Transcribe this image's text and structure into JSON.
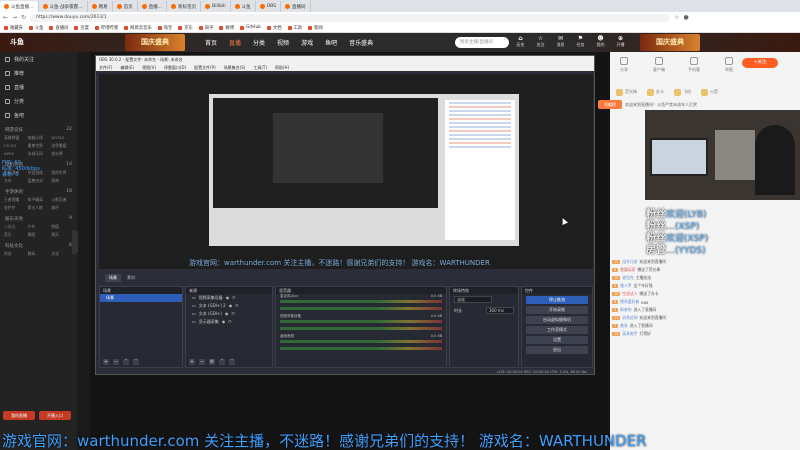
{
  "browser": {
    "tabs": [
      "斗鱼直播…",
      "斗鱼-战争雷霆…",
      "网易",
      "首页",
      "直播…",
      "新标签页",
      "Bilibili",
      "斗鱼",
      "OBS",
      "直播间"
    ],
    "url": "https://www.douyu.com/2613/1",
    "bookmarks": [
      "收藏夹",
      "斗鱼",
      "直播间",
      "百度",
      "哔哩哔哩",
      "网易云音乐",
      "淘宝",
      "京东",
      "知乎",
      "微博",
      "GitHub",
      "文档",
      "工具",
      "新闻"
    ]
  },
  "site": {
    "logo": "斗鱼",
    "promo_left": "国庆盛典",
    "promo_right": "国庆盛典",
    "nav": [
      "首页",
      "直播",
      "分类",
      "视频",
      "游戏",
      "鱼吧",
      "音乐盛典"
    ],
    "search_placeholder": "搜索主播/直播间",
    "header_icons": [
      {
        "glyph": "⌂",
        "label": "历史"
      },
      {
        "glyph": "☆",
        "label": "关注"
      },
      {
        "glyph": "✉",
        "label": "消息"
      },
      {
        "glyph": "⚑",
        "label": "任务"
      },
      {
        "glyph": "☻",
        "label": "我的"
      },
      {
        "glyph": "⊕",
        "label": "开播"
      }
    ]
  },
  "sidebar": {
    "main": [
      {
        "label": "我的关注",
        "icon": "heart-icon"
      },
      {
        "label": "推荐",
        "icon": "star-icon"
      },
      {
        "label": "直播",
        "icon": "tv-icon"
      },
      {
        "label": "分类",
        "icon": "grid-icon"
      },
      {
        "label": "鱼吧",
        "icon": "chat-icon"
      }
    ],
    "sections": [
      {
        "title": "网游竞技",
        "count": "22",
        "items": [
          "英雄联盟",
          "穿越火线",
          "DOTA2",
          "CS:GO",
          "魔兽世界",
          "战争雷霆",
          "APEX",
          "永劫无间",
          "逆水寒"
        ]
      },
      {
        "title": "单机热游",
        "count": "14",
        "items": [
          "主机游戏",
          "怀旧游戏",
          "我的世界",
          "方舟",
          "猛兽派对",
          "原神"
        ]
      },
      {
        "title": "手游休闲",
        "count": "18",
        "items": [
          "王者荣耀",
          "和平精英",
          "火影忍者",
          "金铲铲",
          "第五人格",
          "崩坏"
        ]
      },
      {
        "title": "娱乐天地",
        "count": "9",
        "items": [
          "二次元",
          "户外",
          "颜值",
          "音乐",
          "舞蹈",
          "聊天"
        ]
      },
      {
        "title": "科技文化",
        "count": "6",
        "items": [
          "科技",
          "数码",
          "文化"
        ]
      }
    ],
    "bottom_buttons": [
      "我的直播",
      "开播入口"
    ]
  },
  "obs": {
    "title": "OBS 30.0.2 - 配置文件: 未命名 - 场景: 未命名",
    "menu": [
      "文件(F)",
      "编辑(E)",
      "视图(V)",
      "停靠窗口(D)",
      "配置文件(P)",
      "场景集合(S)",
      "工具(T)",
      "帮助(H)"
    ],
    "caption": "游戏官网：warthunder.com 关注主播，不迷路！感谢兄弟们的支持！ 游戏名：WARTHUNDER",
    "tabs": [
      "场景",
      "素材"
    ],
    "docks": {
      "scenes": {
        "title": "场景",
        "items": [
          "场景"
        ]
      },
      "sources": {
        "title": "来源",
        "items": [
          "视频采集设备",
          "文本 (GDI+) 2",
          "文本 (GDI+)",
          "显示器采集"
        ]
      },
      "mixer": {
        "title": "混音器",
        "channels": [
          {
            "name": "麦克风/Aux",
            "db": "0.0 dB"
          },
          {
            "name": "视频采集设备",
            "db": "0.0 dB"
          },
          {
            "name": "桌面音频",
            "db": "0.0 dB"
          }
        ]
      },
      "transitions": {
        "title": "转场特效",
        "type": "淡化",
        "duration_label": "时长",
        "duration": "300 ms"
      },
      "controls": {
        "title": "控件",
        "buttons": [
          "停止推流",
          "开始录制",
          "启动虚拟摄像机",
          "工作室模式",
          "设置",
          "退出"
        ]
      }
    },
    "status": "LIVE: 00:00:00   REC: 00:00:00   CPU: 2.0%, 60.00 fps"
  },
  "overlays": {
    "left_stats": [
      "FPS: 60",
      "码率: 4500kbps",
      "丢帧: 0"
    ],
    "big_caption": "游戏官网：warthunder.com 关注主播，不迷路！感谢兄弟们的支持！ 游戏名：WARTHUNDER"
  },
  "right_panel": {
    "icons": [
      "分享",
      "客户端",
      "手机看",
      "举报"
    ],
    "follow_button": "+关注",
    "gifts": [
      "荧光棒",
      "办卡",
      "飞机",
      "火箭"
    ],
    "badge": "贡献榜",
    "chat_top": "欢迎来到直播间！斗鱼严禁未成年人打赏",
    "fan_labels": [
      {
        "prefix": "粉丝",
        "text": "欢迎(LYB)"
      },
      {
        "prefix": "粉丝",
        "text": "…(XSP)"
      },
      {
        "prefix": "粉丝",
        "text": "欢迎(XSP)"
      },
      {
        "prefix": "房管",
        "text": "…(YYDS)"
      }
    ],
    "chat": [
      {
        "lv": "12",
        "name": "战车兄弟",
        "msg": "欢迎来到直播间",
        "red": false
      },
      {
        "lv": "8",
        "name": "雷霆玩家",
        "msg": "赠送了荧光棒",
        "red": true
      },
      {
        "lv": "15",
        "name": "老坦克",
        "msg": "主播加油",
        "red": false
      },
      {
        "lv": "5",
        "name": "路人甲",
        "msg": "这个车好强",
        "red": false
      },
      {
        "lv": "20",
        "name": "空战达人",
        "msg": "赠送了办卡",
        "red": true
      },
      {
        "lv": "9",
        "name": "德系爱好者",
        "msg": "666",
        "red": false
      },
      {
        "lv": "3",
        "name": "新来的",
        "msg": "进入了直播间",
        "red": false
      },
      {
        "lv": "11",
        "name": "苏系信仰",
        "msg": "欢迎来到直播间",
        "red": false
      },
      {
        "lv": "7",
        "name": "美系",
        "msg": "进入了直播间",
        "red": false
      },
      {
        "lv": "14",
        "name": "英系炮手",
        "msg": "打得好",
        "red": false
      }
    ]
  }
}
